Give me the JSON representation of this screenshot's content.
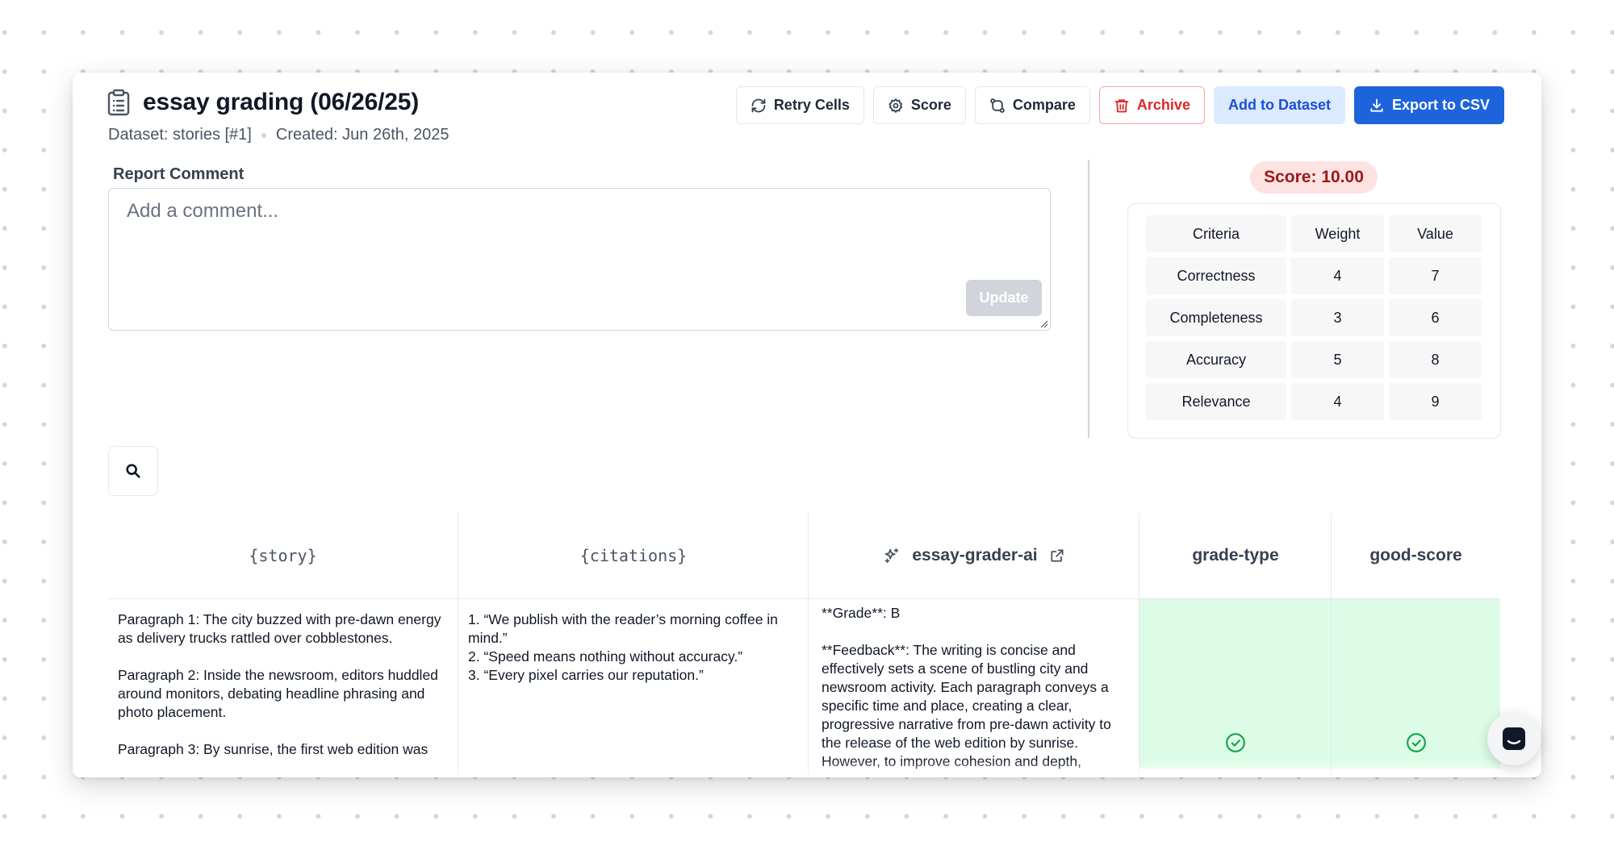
{
  "header": {
    "title": "essay grading (06/26/25)",
    "dataset": "Dataset: stories [#1]",
    "created": "Created: Jun 26th, 2025"
  },
  "toolbar": {
    "retry_cells": "Retry Cells",
    "score": "Score",
    "compare": "Compare",
    "archive": "Archive",
    "add_to_dataset": "Add to Dataset",
    "export_csv": "Export to CSV"
  },
  "comment": {
    "label": "Report Comment",
    "placeholder": "Add a comment...",
    "value": "",
    "update_label": "Update"
  },
  "score": {
    "badge": "Score: 10.00",
    "headers": [
      "Criteria",
      "Weight",
      "Value"
    ],
    "rows": [
      [
        "Correctness",
        "4",
        "7"
      ],
      [
        "Completeness",
        "3",
        "6"
      ],
      [
        "Accuracy",
        "5",
        "8"
      ],
      [
        "Relevance",
        "4",
        "9"
      ]
    ]
  },
  "table": {
    "columns": [
      "{story}",
      "{citations}",
      "essay-grader-ai",
      "grade-type",
      "good-score"
    ],
    "row": {
      "story": "Paragraph 1: The city buzzed with pre-dawn energy as delivery trucks rattled over cobblestones.\n\nParagraph 2: Inside the newsroom, editors huddled around monitors, debating headline phrasing and photo placement.\n\nParagraph 3: By sunrise, the first web edition was",
      "citations": "1. “We publish with the reader’s morning coffee in mind.”\n2. “Speed means nothing without accuracy.”\n3. “Every pixel carries our reputation.”",
      "output": "**Grade**: B\n\n**Feedback**: The writing is concise and effectively sets a scene of bustling city and newsroom activity. Each paragraph conveys a specific time and place, creating a clear, progressive narrative from pre-dawn activity to the release of the web edition by sunrise. However, to improve cohesion and depth,",
      "grade_type": "pass",
      "good_score": "pass"
    }
  },
  "colors": {
    "primary": "#1d63dc",
    "danger": "#dc2626",
    "pass_bg": "#dcfce7",
    "pass_icon": "#16a34a",
    "score_badge_bg": "#fee2e2"
  }
}
